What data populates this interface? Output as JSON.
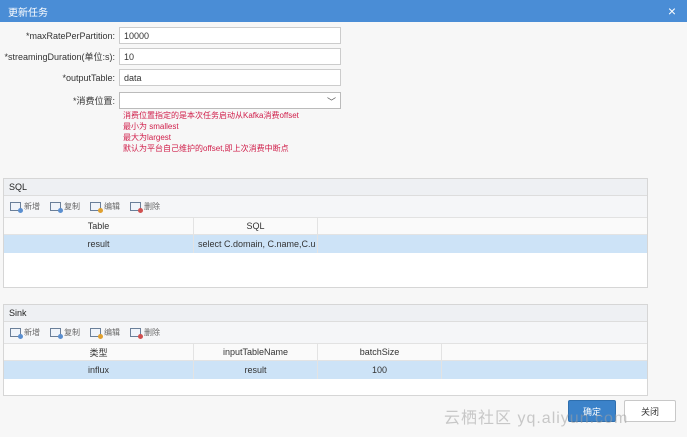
{
  "dialog": {
    "title": "更新任务"
  },
  "form": {
    "fields": [
      {
        "label": "*maxRatePerPartition:",
        "value": "10000"
      },
      {
        "label": "*streamingDuration(单位:s):",
        "value": "10"
      },
      {
        "label": "*outputTable:",
        "value": "data"
      }
    ],
    "position_label": "*消费位置:",
    "position_value": "",
    "hint_lines": [
      "消费位置指定的是本次任务启动从Kafka消费offset",
      "最小为 smallest",
      "最大为largest",
      "默认为平台自己维护的offset,即上次消费中断点"
    ]
  },
  "sql_panel": {
    "title": "SQL",
    "toolbar": [
      "新增",
      "复制",
      "编辑",
      "删除"
    ],
    "columns": [
      "Table",
      "SQL"
    ],
    "rows": [
      {
        "table": "result",
        "sql": "select C.domain, C.name,C.u"
      }
    ]
  },
  "sink_panel": {
    "title": "Sink",
    "toolbar": [
      "新增",
      "复制",
      "编辑",
      "删除"
    ],
    "columns": [
      "类型",
      "inputTableName",
      "batchSize"
    ],
    "rows": [
      {
        "type": "influx",
        "input": "result",
        "batch": "100"
      }
    ]
  },
  "footer": {
    "save": "确定",
    "close": "关闭"
  },
  "watermark": "云栖社区 yq.aliyun.com",
  "colors": {
    "titlebar": "#4a8dd6",
    "hint": "#d01e4a",
    "selected_row": "#cde3f7"
  }
}
